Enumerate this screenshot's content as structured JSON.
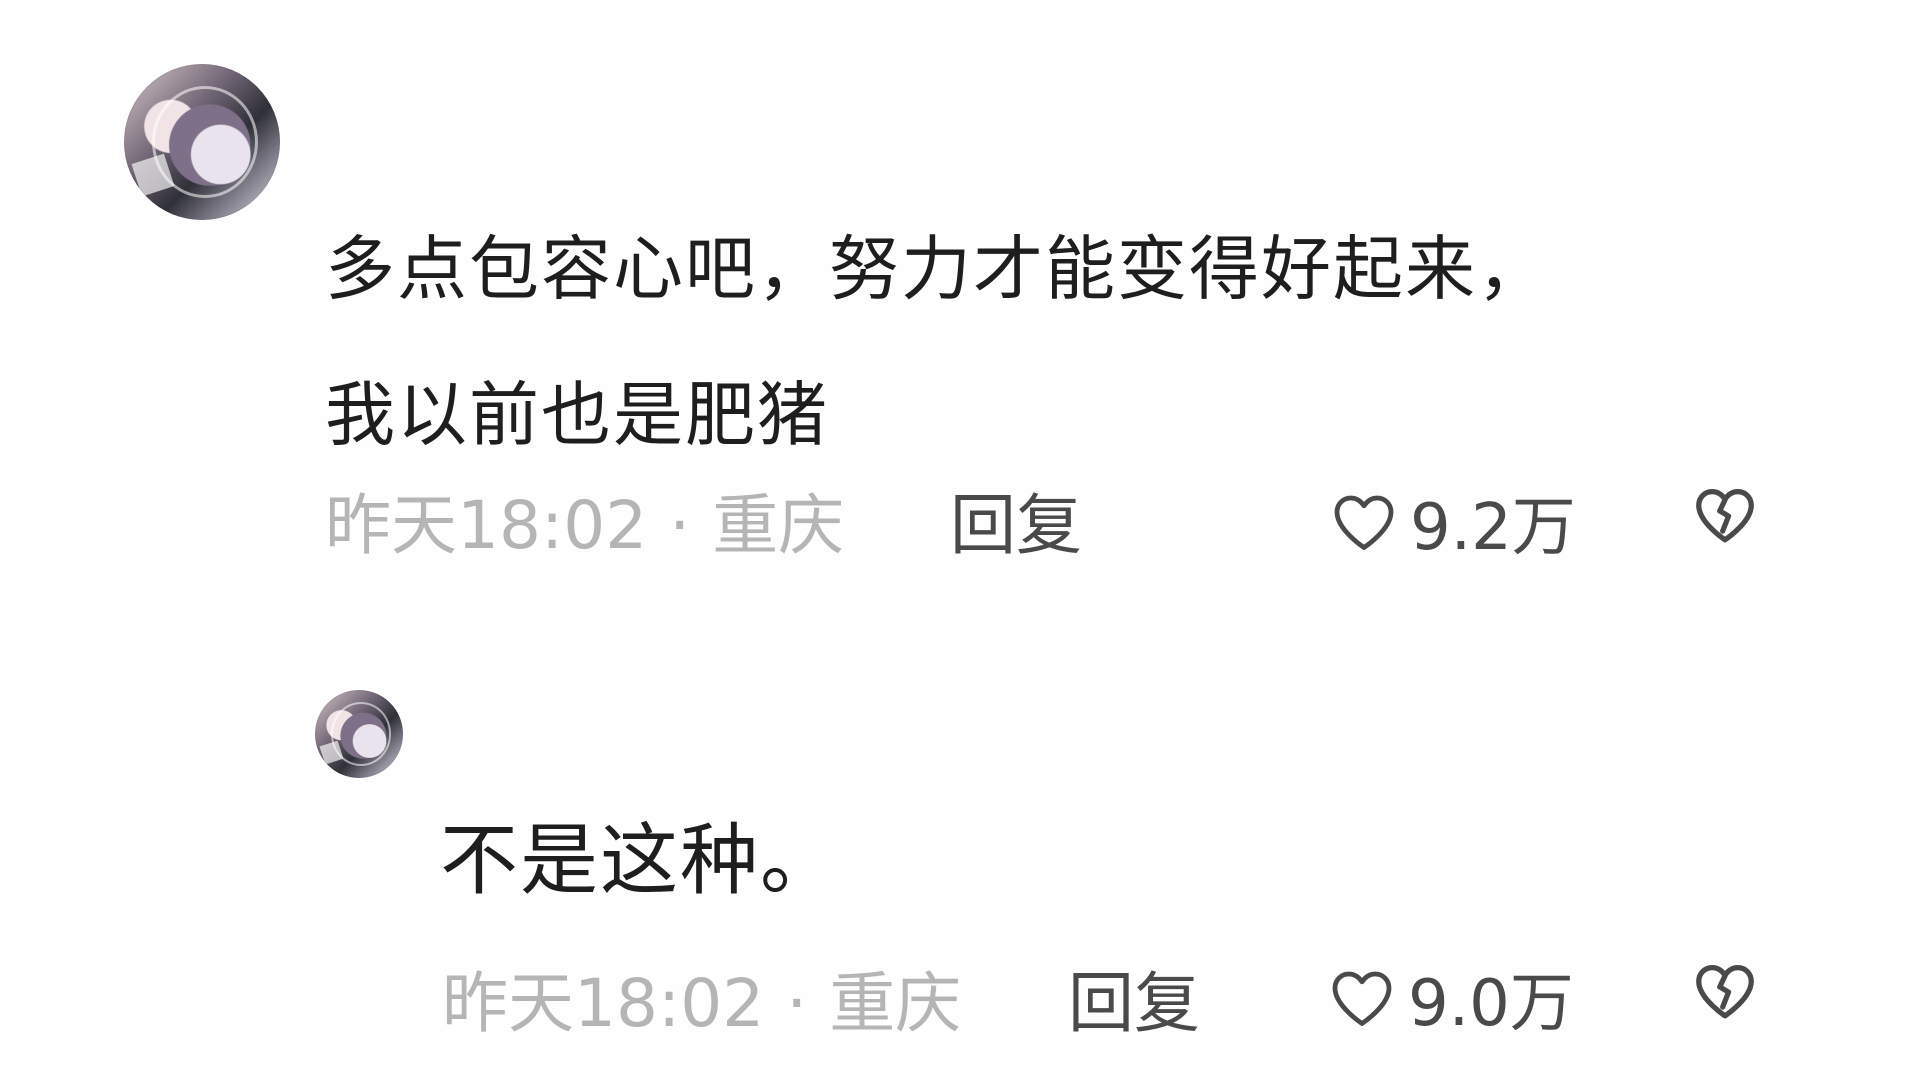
{
  "comment": {
    "text_line1": "多点包容心吧，努力才能变得好起来，",
    "text_line2": "我以前也是肥猪",
    "time": "昨天18:02",
    "separator": "·",
    "location": "重庆",
    "reply_label": "回复",
    "like_count": "9.2万",
    "like_icon": "heart-outline-icon",
    "dislike_icon": "broken-heart-icon"
  },
  "reply": {
    "text": "不是这种。",
    "time": "昨天18:02",
    "separator": "·",
    "location": "重庆",
    "reply_label": "回复",
    "like_count": "9.0万",
    "like_icon": "heart-outline-icon",
    "dislike_icon": "broken-heart-icon"
  },
  "colors": {
    "text_primary": "#1e1e1e",
    "text_meta": "#b5b5b5",
    "text_action": "#4a4a4a",
    "background": "#fefefe"
  }
}
